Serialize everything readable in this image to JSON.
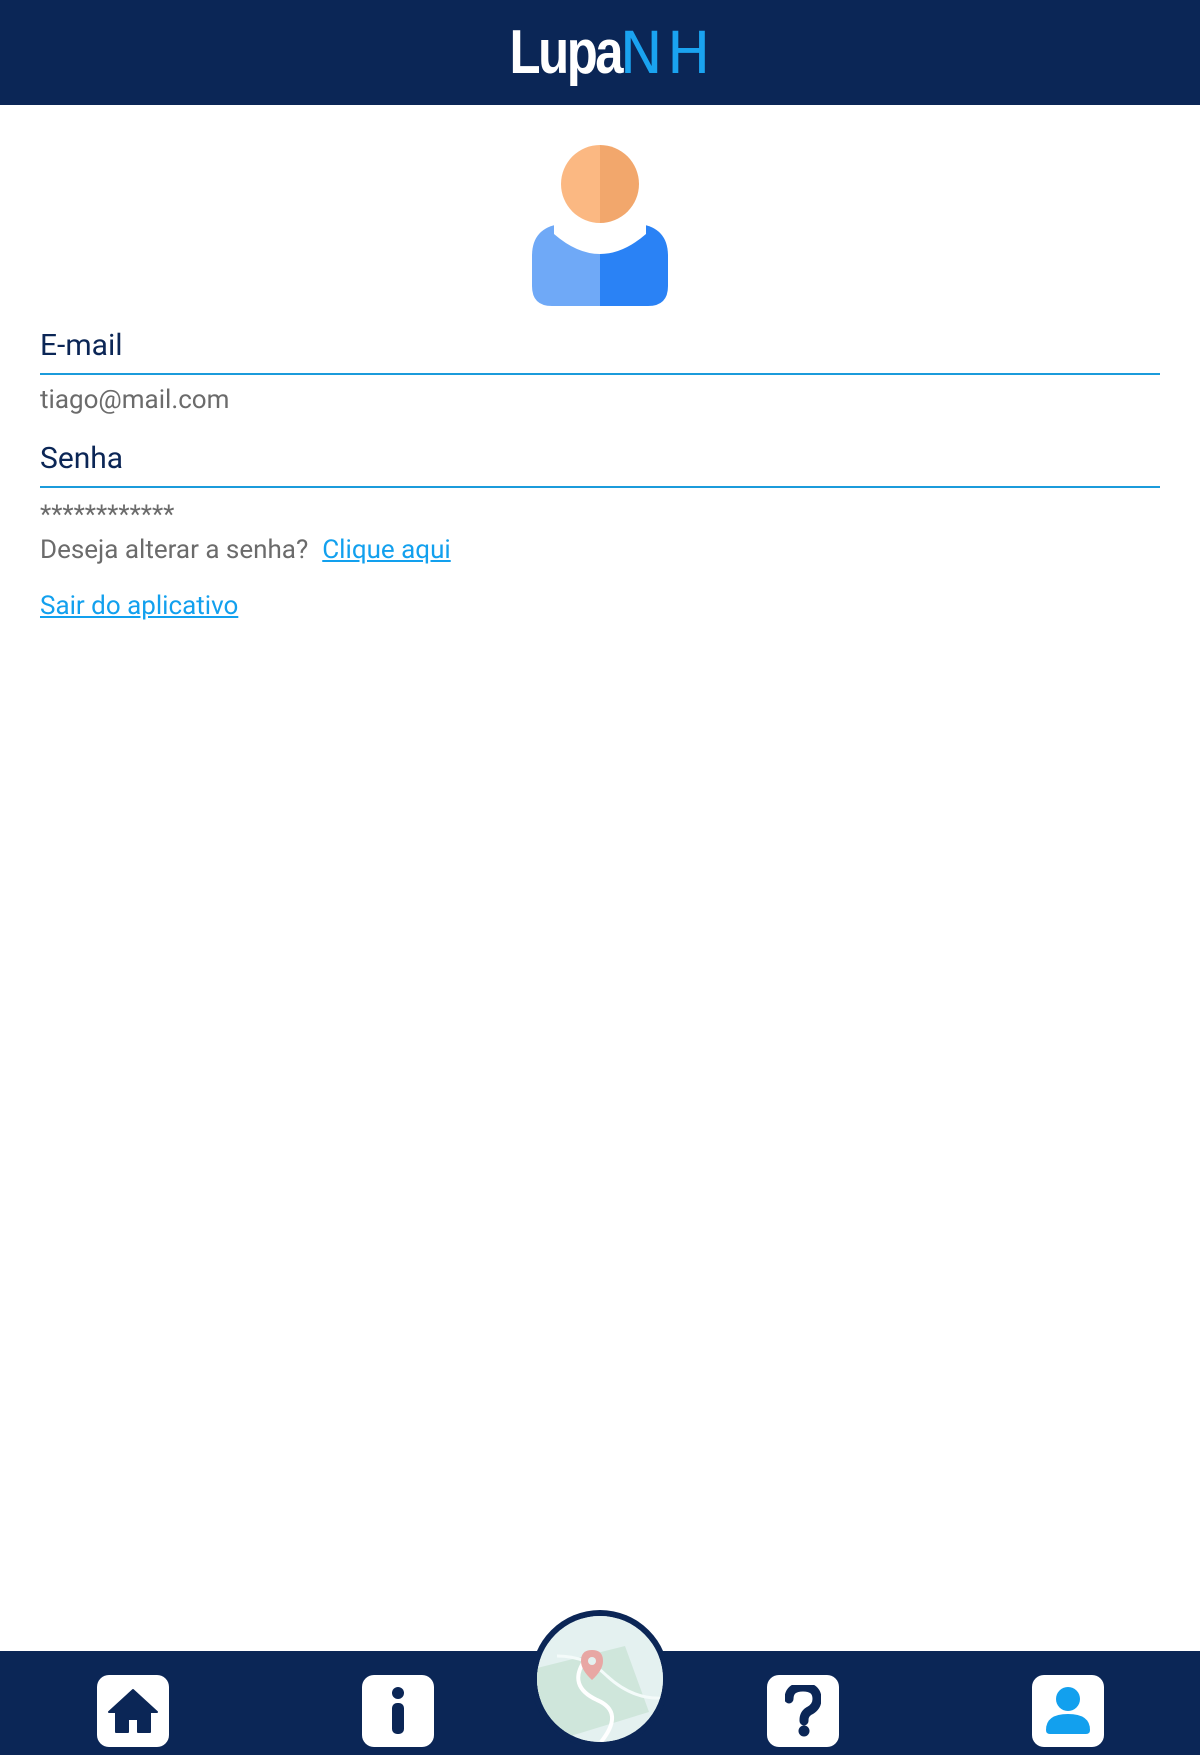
{
  "header": {
    "logo_part1": "Lupa",
    "logo_part2": "NH"
  },
  "profile": {
    "email_label": "E-mail",
    "email_value": "tiago@mail.com",
    "password_label": "Senha",
    "password_value": "************",
    "change_password_prompt": "Deseja alterar a senha?",
    "change_password_link": "Clique aqui",
    "logout_link": "Sair do aplicativo"
  },
  "nav": {
    "items": [
      {
        "icon": "home-icon"
      },
      {
        "icon": "info-icon"
      },
      {
        "icon": "map-icon"
      },
      {
        "icon": "help-icon"
      },
      {
        "icon": "user-icon",
        "active": true
      }
    ]
  },
  "colors": {
    "header_bg": "#0b2656",
    "accent": "#12a0ee",
    "divider": "#1b9bdb",
    "text_muted": "#6b6b6b",
    "active_icon": "#12a0ee"
  }
}
